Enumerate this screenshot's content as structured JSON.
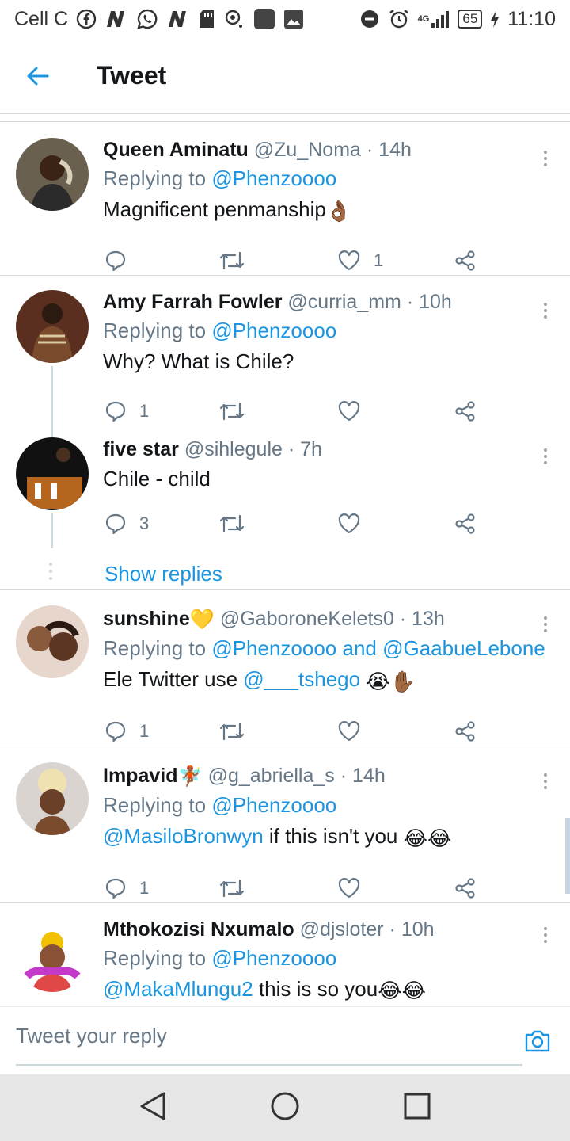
{
  "status_bar": {
    "carrier": "Cell C",
    "network": "4G",
    "battery": "65",
    "time": "11:10"
  },
  "header": {
    "title": "Tweet"
  },
  "tweets": [
    {
      "name": "Queen Aminatu",
      "handle": "@Zu_Noma",
      "time": "14h",
      "replying_prefix": "Replying to",
      "replying_to": "@Phenzoooo",
      "text": "Magnificent penmanship",
      "text_emoji": "👌🏾",
      "reply_count": "",
      "like_count": "1"
    },
    {
      "name": "Amy Farrah Fowler",
      "handle": "@curria_mm",
      "time": "10h",
      "replying_prefix": "Replying to",
      "replying_to": "@Phenzoooo",
      "text": "Why? What is Chile?",
      "reply_count": "1",
      "like_count": ""
    },
    {
      "name": "five star",
      "handle": "@sihlegule",
      "time": "7h",
      "text": "Chile - child",
      "reply_count": "3",
      "like_count": "",
      "show_replies": "Show replies"
    },
    {
      "name": "sunshine",
      "name_emoji": "💛",
      "handle": "@GaboroneKelets0",
      "time": "13h",
      "replying_prefix": "Replying to",
      "replying_to": "@Phenzoooo and @GaabueLebone",
      "text": "Ele Twitter use ",
      "mention": "@___tshego",
      "text_emoji": "😭✋🏾",
      "reply_count": "1",
      "like_count": ""
    },
    {
      "name": "Impavid",
      "name_emoji": "🧚🏾",
      "handle": "@g_abriella_s",
      "time": "14h",
      "replying_prefix": "Replying to",
      "replying_to": "@Phenzoooo",
      "mention": "@MasiloBronwyn",
      "text": " if this isn't you ",
      "text_emoji": "😂😂",
      "reply_count": "1",
      "like_count": ""
    },
    {
      "name": "Mthokozisi Nxumalo",
      "handle": "@djsloter",
      "time": "10h",
      "replying_prefix": "Replying to",
      "replying_to": "@Phenzoooo",
      "mention": "@MakaMlungu2",
      "text": " this is so you",
      "text_emoji": "😂😂"
    }
  ],
  "reply_bar": {
    "placeholder": "Tweet your reply"
  },
  "icons": {
    "back": "arrow-left-icon",
    "reply": "comment-icon",
    "retweet": "retweet-icon",
    "like": "heart-icon",
    "share": "share-icon",
    "more": "more-vertical-icon",
    "camera": "camera-icon"
  },
  "colors": {
    "accent": "#1b95e0",
    "secondary_text": "#657786",
    "divider": "#d9d9d9"
  }
}
